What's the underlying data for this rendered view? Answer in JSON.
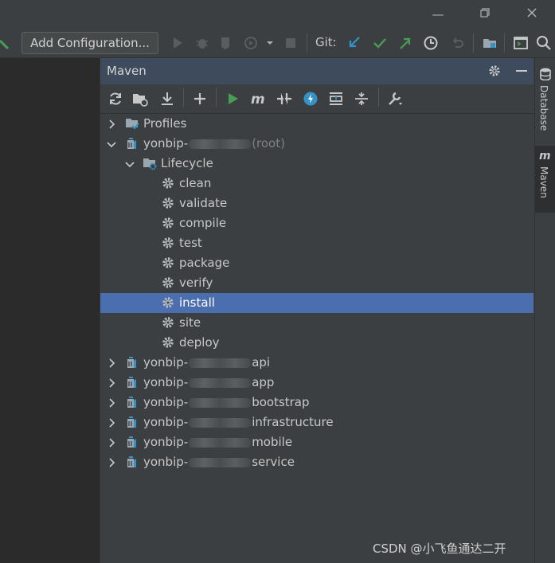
{
  "toolbar": {
    "add_configuration": "Add Configuration...",
    "git_label": "Git:"
  },
  "maven_panel": {
    "title": "Maven"
  },
  "side_tabs": {
    "database": "Database",
    "maven": "Maven"
  },
  "tree": {
    "profiles": "Profiles",
    "root": {
      "prefix": "yonbip-",
      "suffix": "(root)"
    },
    "lifecycle": "Lifecycle",
    "goals": [
      "clean",
      "validate",
      "compile",
      "test",
      "package",
      "verify",
      "install",
      "site",
      "deploy"
    ],
    "selected_goal": "install",
    "modules": [
      {
        "prefix": "yonbip-",
        "suffix": "api"
      },
      {
        "prefix": "yonbip-",
        "suffix": "app"
      },
      {
        "prefix": "yonbip-",
        "suffix": "bootstrap"
      },
      {
        "prefix": "yonbip-",
        "suffix": "infrastructure"
      },
      {
        "prefix": "yonbip-",
        "suffix": "mobile"
      },
      {
        "prefix": "yonbip-",
        "suffix": "service"
      }
    ]
  },
  "watermark": "CSDN @小飞鱼通达二开",
  "colors": {
    "selection": "#4b6eaf",
    "panel_header": "#3d4b5c",
    "run_green": "#499c54",
    "git_blue": "#3592c4"
  }
}
